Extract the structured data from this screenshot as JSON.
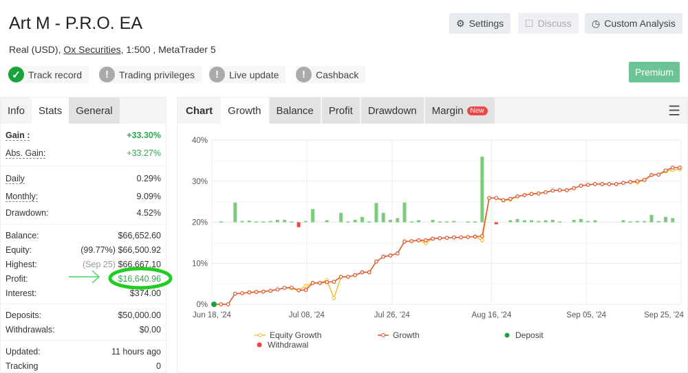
{
  "header": {
    "title": "Art M - P.R.O. EA",
    "account_type": "Real (USD),",
    "broker": "Ox Securities,",
    "leverage": "1:500 ,",
    "platform": "MetaTrader 5",
    "buttons": {
      "settings": "Settings",
      "discuss": "Discuss",
      "custom_analysis": "Custom Analysis",
      "premium": "Premium"
    },
    "badges": [
      {
        "label": "Track record",
        "status": "verified",
        "icon": "check-icon"
      },
      {
        "label": "Trading privileges",
        "status": "warning",
        "icon": "exclamation-icon"
      },
      {
        "label": "Live update",
        "status": "warning",
        "icon": "exclamation-icon"
      },
      {
        "label": "Cashback",
        "status": "warning",
        "icon": "exclamation-icon"
      }
    ]
  },
  "left_tabs": [
    "Info",
    "Stats",
    "General"
  ],
  "stats": {
    "gain": {
      "label": "Gain :",
      "value": "+33.30%"
    },
    "abs_gain": {
      "label": "Abs. Gain:",
      "value": "+33.27%"
    },
    "daily": {
      "label": "Daily",
      "value": "0.29%"
    },
    "monthly": {
      "label": "Monthly:",
      "value": "9.09%"
    },
    "drawdown": {
      "label": "Drawdown:",
      "value": "4.52%"
    },
    "balance": {
      "label": "Balance:",
      "value": "$66,652.60"
    },
    "equity": {
      "label": "Equity:",
      "note": "(99.77%)",
      "value": "$66,500.92"
    },
    "highest": {
      "label": "Highest:",
      "note": "(Sep 25)",
      "value": "$66,667.10"
    },
    "profit": {
      "label": "Profit:",
      "value": "$16,640.96"
    },
    "interest": {
      "label": "Interest:",
      "value": "$374.00"
    },
    "deposits": {
      "label": "Deposits:",
      "value": "$50,000.00"
    },
    "withdrawals": {
      "label": "Withdrawals:",
      "value": "$0.00"
    },
    "updated": {
      "label": "Updated:",
      "value": "11 hours ago"
    },
    "tracking": {
      "label": "Tracking",
      "value": "0"
    }
  },
  "chart_tabs": {
    "chart": "Chart",
    "tabs": [
      "Growth",
      "Balance",
      "Profit",
      "Drawdown",
      "Margin"
    ],
    "new_badge": "New",
    "active": "Growth"
  },
  "colors": {
    "growth": "#e0522c",
    "equity": "#f2c12e",
    "bar_pos": "#7dcc7d",
    "bar_neg": "#ee4444",
    "deposit": "#1aa33a",
    "annotation": "#22cc22"
  },
  "chart_data": {
    "type": "line",
    "ylim": [
      0,
      40
    ],
    "yticks": [
      "0%",
      "10%",
      "20%",
      "30%",
      "40%"
    ],
    "ytick_values": [
      0,
      10,
      20,
      30,
      40
    ],
    "xticks": [
      {
        "label": "Jun 18, '24",
        "date": "2024-06-18"
      },
      {
        "label": "Jul 08, '24",
        "date": "2024-07-08"
      },
      {
        "label": "Jul 26, '24",
        "date": "2024-07-26"
      },
      {
        "label": "Aug 16, '24",
        "date": "2024-08-16"
      },
      {
        "label": "Sep 05, '24",
        "date": "2024-09-05"
      },
      {
        "label": "Sep 25, '24",
        "date": "2024-09-25"
      }
    ],
    "grid": true,
    "legend_placement": "bottom",
    "series": [
      {
        "name": "Growth",
        "values": [
          0,
          0,
          0,
          2.6,
          2.7,
          2.9,
          3.0,
          3.1,
          3.3,
          3.6,
          4.0,
          4.1,
          3.4,
          3.5,
          5.2,
          5.2,
          5.4,
          5.5,
          6.7,
          6.7,
          7.1,
          7.8,
          7.8,
          10.4,
          11.6,
          11.9,
          12.4,
          15.3,
          15.4,
          15.6,
          15.6,
          16.0,
          16.1,
          16.2,
          16.3,
          16.3,
          16.4,
          16.5,
          16.6,
          25.9,
          25.9,
          25.4,
          25.7,
          26.3,
          26.6,
          26.9,
          27.0,
          27.3,
          27.7,
          27.8,
          27.8,
          28.3,
          28.9,
          29.1,
          29.3,
          29.3,
          29.3,
          29.3,
          29.6,
          29.8,
          30.0,
          30.3,
          31.5,
          31.6,
          32.6,
          33.3,
          33.3
        ]
      },
      {
        "name": "Equity Growth",
        "values": [
          0,
          0,
          0,
          2.6,
          2.7,
          2.9,
          3.0,
          3.1,
          3.3,
          3.6,
          4.0,
          3.9,
          3.4,
          4.5,
          5.2,
          5.2,
          5.9,
          1.5,
          6.7,
          6.7,
          7.1,
          7.8,
          7.8,
          10.4,
          11.6,
          11.9,
          12.4,
          15.3,
          15.4,
          15.6,
          14.9,
          16.0,
          16.1,
          16.2,
          16.3,
          16.3,
          16.4,
          16.5,
          15.6,
          25.9,
          25.9,
          25.3,
          25.5,
          26.3,
          26.6,
          26.9,
          27.0,
          27.3,
          27.7,
          27.8,
          27.8,
          28.3,
          28.9,
          29.1,
          29.3,
          29.3,
          29.3,
          29.3,
          29.6,
          29.8,
          29.7,
          30.3,
          31.5,
          31.6,
          32.4,
          32.7,
          32.9
        ]
      }
    ],
    "bars_baseline": 20,
    "bars": [
      0,
      0.2,
      0,
      4.8,
      0.3,
      0.4,
      0.2,
      0.2,
      0.3,
      0.6,
      0.6,
      0.2,
      -1.2,
      0.3,
      3.2,
      0,
      0.5,
      0,
      2.3,
      0.2,
      0.6,
      1.3,
      0.2,
      4.7,
      2.3,
      0.6,
      1.0,
      4.8,
      0.2,
      0.5,
      0,
      0.6,
      0.2,
      0.2,
      0.3,
      0,
      0.2,
      0.2,
      16,
      0,
      -0.5,
      0,
      0.5,
      0.8,
      0.5,
      0.5,
      0.3,
      0.5,
      0.6,
      0.2,
      0,
      0.6,
      0.8,
      0.3,
      0.5,
      0,
      0,
      0,
      0.5,
      0.2,
      0.3,
      0.3,
      1.8,
      0.3,
      1.3,
      1.0,
      0
    ],
    "deposit_index": 0,
    "legend": [
      "Equity Growth",
      "Growth",
      "Deposit",
      "Withdrawal"
    ]
  }
}
